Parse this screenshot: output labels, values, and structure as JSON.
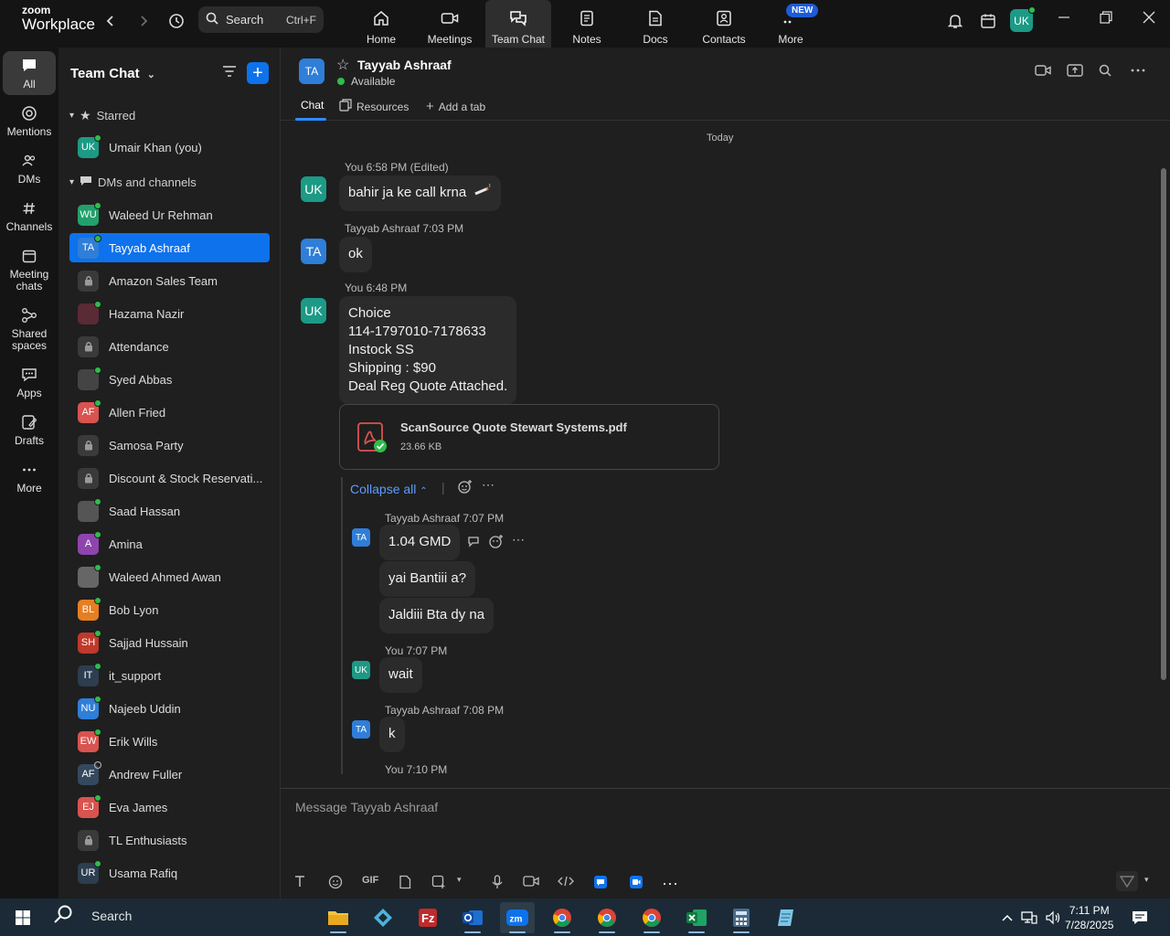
{
  "topbar": {
    "logo_line1": "zoom",
    "logo_line2": "Workplace",
    "search_placeholder": "Search",
    "search_shortcut": "Ctrl+F",
    "tabs": [
      {
        "label": "Home",
        "icon": "home-icon"
      },
      {
        "label": "Meetings",
        "icon": "video-camera-icon"
      },
      {
        "label": "Team Chat",
        "icon": "chat-bubbles-icon",
        "active": true
      },
      {
        "label": "Notes",
        "icon": "notes-icon"
      },
      {
        "label": "Docs",
        "icon": "document-icon"
      },
      {
        "label": "Contacts",
        "icon": "contacts-icon"
      },
      {
        "label": "More",
        "icon": "more-icon"
      }
    ],
    "new_badge": "NEW",
    "user_initials": "UK"
  },
  "rail": {
    "items": [
      {
        "label": "All",
        "icon": "chat-icon",
        "active": true
      },
      {
        "label": "Mentions",
        "icon": "at-icon"
      },
      {
        "label": "DMs",
        "icon": "people-icon"
      },
      {
        "label": "Channels",
        "icon": "hash-icon"
      },
      {
        "label": "Meeting chats",
        "icon": "calendar-icon"
      },
      {
        "label": "Shared spaces",
        "icon": "shared-spaces-icon"
      },
      {
        "label": "Apps",
        "icon": "apps-icon"
      },
      {
        "label": "Drafts",
        "icon": "drafts-icon"
      },
      {
        "label": "More",
        "icon": "ellipsis-icon"
      }
    ]
  },
  "sidebar": {
    "title": "Team Chat",
    "starred_label": "Starred",
    "dms_label": "DMs and channels",
    "starred": [
      {
        "name": "Umair Khan (you)",
        "initials": "UK",
        "color": "#1c9a86",
        "status": "online"
      }
    ],
    "chats": [
      {
        "name": "Waleed Ur Rehman",
        "initials": "WU",
        "color": "#22a06b",
        "status": "online"
      },
      {
        "name": "Tayyab Ashraaf",
        "initials": "TA",
        "color": "#2f7ed8",
        "status": "online",
        "active": true
      },
      {
        "name": "Amazon Sales Team",
        "initials": "",
        "color": "#3a3a3a",
        "status": "lock"
      },
      {
        "name": "Hazama Nazir",
        "initials": "",
        "color": "#5a2a35",
        "status": "online"
      },
      {
        "name": "Attendance",
        "initials": "",
        "color": "#3a3a3a",
        "status": "lock"
      },
      {
        "name": "Syed Abbas",
        "initials": "",
        "color": "#444444",
        "status": "online"
      },
      {
        "name": "Allen Fried",
        "initials": "AF",
        "color": "#d9534f",
        "status": "online"
      },
      {
        "name": "Samosa Party",
        "initials": "",
        "color": "#3a3a3a",
        "status": "lock"
      },
      {
        "name": "Discount & Stock Reservati...",
        "initials": "",
        "color": "#3a3a3a",
        "status": "lock"
      },
      {
        "name": "Saad Hassan",
        "initials": "",
        "color": "#555555",
        "status": "online"
      },
      {
        "name": "Amina",
        "initials": "A",
        "color": "#8e44ad",
        "status": "online"
      },
      {
        "name": "Waleed Ahmed Awan",
        "initials": "",
        "color": "#666666",
        "status": "online"
      },
      {
        "name": "Bob Lyon",
        "initials": "BL",
        "color": "#e67e22",
        "status": "online"
      },
      {
        "name": "Sajjad Hussain",
        "initials": "SH",
        "color": "#c0392b",
        "status": "online"
      },
      {
        "name": "it_support",
        "initials": "IT",
        "color": "#2c3e50",
        "status": "online"
      },
      {
        "name": "Najeeb Uddin",
        "initials": "NU",
        "color": "#2f7ed8",
        "status": "online"
      },
      {
        "name": "Erik Wills",
        "initials": "EW",
        "color": "#d9534f",
        "status": "online"
      },
      {
        "name": "Andrew Fuller",
        "initials": "AF",
        "color": "#34495e",
        "status": "offline"
      },
      {
        "name": "Eva James",
        "initials": "EJ",
        "color": "#d9534f",
        "status": "online"
      },
      {
        "name": "TL Enthusiasts",
        "initials": "",
        "color": "#3a3a3a",
        "status": "lock"
      },
      {
        "name": "Usama Rafiq",
        "initials": "UR",
        "color": "#2c3e50",
        "status": "online"
      }
    ]
  },
  "chat": {
    "name": "Tayyab Ashraaf",
    "initials": "TA",
    "status": "Available",
    "tabs": [
      "Chat",
      "Resources",
      "Add a tab"
    ],
    "today": "Today",
    "msg1": {
      "meta": "You 6:58 PM (Edited)",
      "text": "bahir ja ke call krna",
      "initials": "UK"
    },
    "msg2": {
      "meta": "Tayyab Ashraaf 7:03 PM",
      "text": "ok",
      "initials": "TA"
    },
    "msg3": {
      "meta": "You 6:48 PM",
      "initials": "UK",
      "lines": [
        "Choice",
        "114-1797010-7178633",
        "Instock SS",
        "Shipping : $90",
        "Deal Reg Quote Attached."
      ]
    },
    "file": {
      "name": "ScanSource Quote Stewart Systems.pdf",
      "size": "23.66 KB"
    },
    "collapse_label": "Collapse all",
    "thread": [
      {
        "meta": "Tayyab Ashraaf 7:07 PM",
        "initials": "TA",
        "texts": [
          "1.04 GMD",
          "yai Bantiii a?",
          "Jaldiii Bta dy na"
        ]
      },
      {
        "meta": "You 7:07 PM",
        "initials": "UK",
        "texts": [
          "wait"
        ]
      },
      {
        "meta": "Tayyab Ashraaf 7:08 PM",
        "initials": "TA",
        "texts": [
          "k"
        ]
      },
      {
        "meta": "You 7:10 PM",
        "initials": "",
        "texts": []
      }
    ],
    "composer_placeholder": "Message Tayyab Ashraaf"
  },
  "taskbar": {
    "search_label": "Search",
    "time": "7:11 PM",
    "date": "7/28/2025",
    "apps": [
      "file-explorer-icon",
      "app-icon",
      "filezilla-icon",
      "outlook-icon",
      "zoom-icon",
      "chrome-icon",
      "chrome-icon",
      "chrome-icon",
      "excel-icon",
      "calculator-icon",
      "notepad-icon"
    ]
  }
}
